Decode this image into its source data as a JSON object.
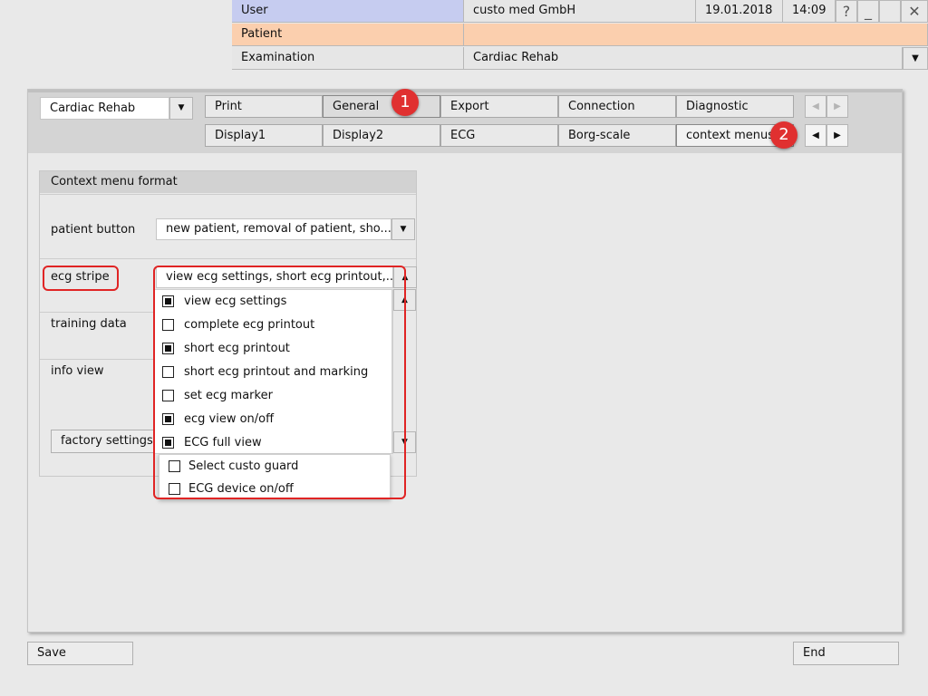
{
  "header": {
    "user_label": "User",
    "user_value": "custo med GmbH",
    "date": "19.01.2018",
    "time": "14:09",
    "help_icon": "?",
    "minimize_icon": "_",
    "close_icon": "✕",
    "patient_label": "Patient",
    "patient_value": "",
    "examination_label": "Examination",
    "examination_value": "Cardiac Rehab",
    "examination_dropdown_icon": "▼"
  },
  "toolbar": {
    "profile_select": "Cardiac Rehab",
    "tabs_row1": [
      "Print",
      "General",
      "Export",
      "Connection",
      "Diagnostic"
    ],
    "tabs_row2": [
      "Display1",
      "Display2",
      "ECG",
      "Borg-scale",
      "context menus"
    ],
    "arrow_left": "◀",
    "arrow_right": "▶",
    "badge1": "1",
    "badge2": "2"
  },
  "section": {
    "title": "Context menu format",
    "rows": {
      "patient_button_label": "patient button",
      "patient_button_value": "new patient, removal of patient, sho...",
      "ecg_stripe_label": "ecg stripe",
      "ecg_stripe_value": "view ecg settings, short ecg printout,...",
      "training_data_label": "training data",
      "info_view_label": "info view"
    },
    "factory_settings": "factory settings"
  },
  "dropdown": {
    "items": [
      {
        "label": "view ecg settings",
        "checked": true
      },
      {
        "label": "complete ecg printout",
        "checked": false
      },
      {
        "label": "short ecg printout",
        "checked": true
      },
      {
        "label": "short ecg printout and marking",
        "checked": false
      },
      {
        "label": "set ecg marker",
        "checked": false
      },
      {
        "label": "ecg view on/off",
        "checked": true
      },
      {
        "label": "ECG full view",
        "checked": true
      }
    ],
    "extra_items": [
      {
        "label": "Select custo guard",
        "checked": false
      },
      {
        "label": "ECG device on/off",
        "checked": false
      }
    ]
  },
  "footer": {
    "save": "Save",
    "end": "End"
  },
  "colors": {
    "header_blue": "#c6ccf0",
    "header_orange": "#fbcfae",
    "badge_red": "#e03030",
    "highlight_red": "#e02424"
  }
}
